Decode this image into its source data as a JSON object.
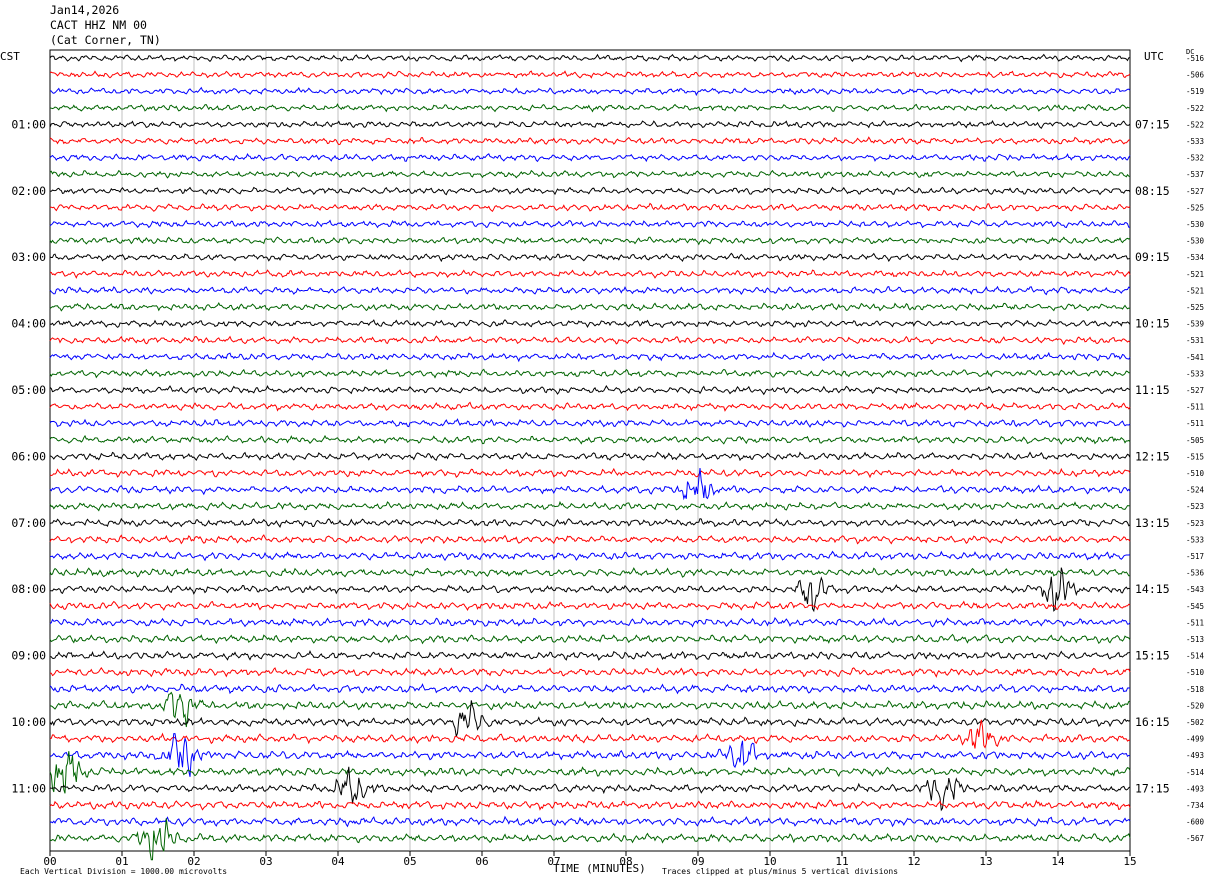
{
  "header": {
    "date": "Jan14,2026",
    "station": "CACT HHZ NM 00",
    "location": "(Cat Corner, TN)"
  },
  "left_tz": "CST",
  "right_tz": "UTC",
  "dc_label": "DC",
  "footer": {
    "scale_note": "Each Vertical Division = 1000.00 microvolts",
    "xlabel": "TIME (MINUTES)",
    "clip_note": "Traces clipped at plus/minus 5 vertical divisions"
  },
  "chart_data": {
    "type": "line",
    "title": "",
    "xlabel": "TIME (MINUTES)",
    "xlim": [
      0,
      15
    ],
    "x_ticks": [
      "00",
      "01",
      "02",
      "03",
      "04",
      "05",
      "06",
      "07",
      "08",
      "09",
      "10",
      "11",
      "12",
      "13",
      "14",
      "15"
    ],
    "line_count": 48,
    "line_colors": [
      "#000000",
      "#ff0000",
      "#0000ff",
      "#006400"
    ],
    "left_hour_labels": [
      "01:00",
      "02:00",
      "03:00",
      "04:00",
      "05:00",
      "06:00",
      "07:00",
      "08:00",
      "09:00",
      "10:00",
      "11:00"
    ],
    "right_hour_labels": [
      "07:15",
      "08:15",
      "09:15",
      "10:15",
      "11:15",
      "12:15",
      "13:15",
      "14:15",
      "15:15",
      "16:15",
      "17:15"
    ],
    "dc_offsets": [
      "-516",
      "-506",
      "-519",
      "-522",
      "-522",
      "-533",
      "-532",
      "-537",
      "-527",
      "-525",
      "-530",
      "-530",
      "-534",
      "-521",
      "-521",
      "-525",
      "-539",
      "-531",
      "-541",
      "-533",
      "-527",
      "-511",
      "-511",
      "-505",
      "-515",
      "-510",
      "-524",
      "-523",
      "-523",
      "-533",
      "-517",
      "-536",
      "-543",
      "-545",
      "-511",
      "-513",
      "-514",
      "-510",
      "-518",
      "-520",
      "-502",
      "-499",
      "-493",
      "-514",
      "-493",
      "-734",
      "-600",
      "-567"
    ],
    "events": [
      {
        "line": 26,
        "minute": 9.0,
        "amplitude": 2.0
      },
      {
        "line": 32,
        "minute": 10.6,
        "amplitude": 2.2
      },
      {
        "line": 32,
        "minute": 14.0,
        "amplitude": 2.2
      },
      {
        "line": 39,
        "minute": 1.8,
        "amplitude": 2.2
      },
      {
        "line": 40,
        "minute": 5.8,
        "amplitude": 1.6
      },
      {
        "line": 41,
        "minute": 12.9,
        "amplitude": 2.0
      },
      {
        "line": 42,
        "minute": 1.8,
        "amplitude": 2.6
      },
      {
        "line": 42,
        "minute": 9.6,
        "amplitude": 1.6
      },
      {
        "line": 43,
        "minute": 0.2,
        "amplitude": 2.4
      },
      {
        "line": 44,
        "minute": 4.2,
        "amplitude": 2.2
      },
      {
        "line": 44,
        "minute": 12.4,
        "amplitude": 2.0
      },
      {
        "line": 47,
        "minute": 1.5,
        "amplitude": 2.6
      }
    ]
  }
}
